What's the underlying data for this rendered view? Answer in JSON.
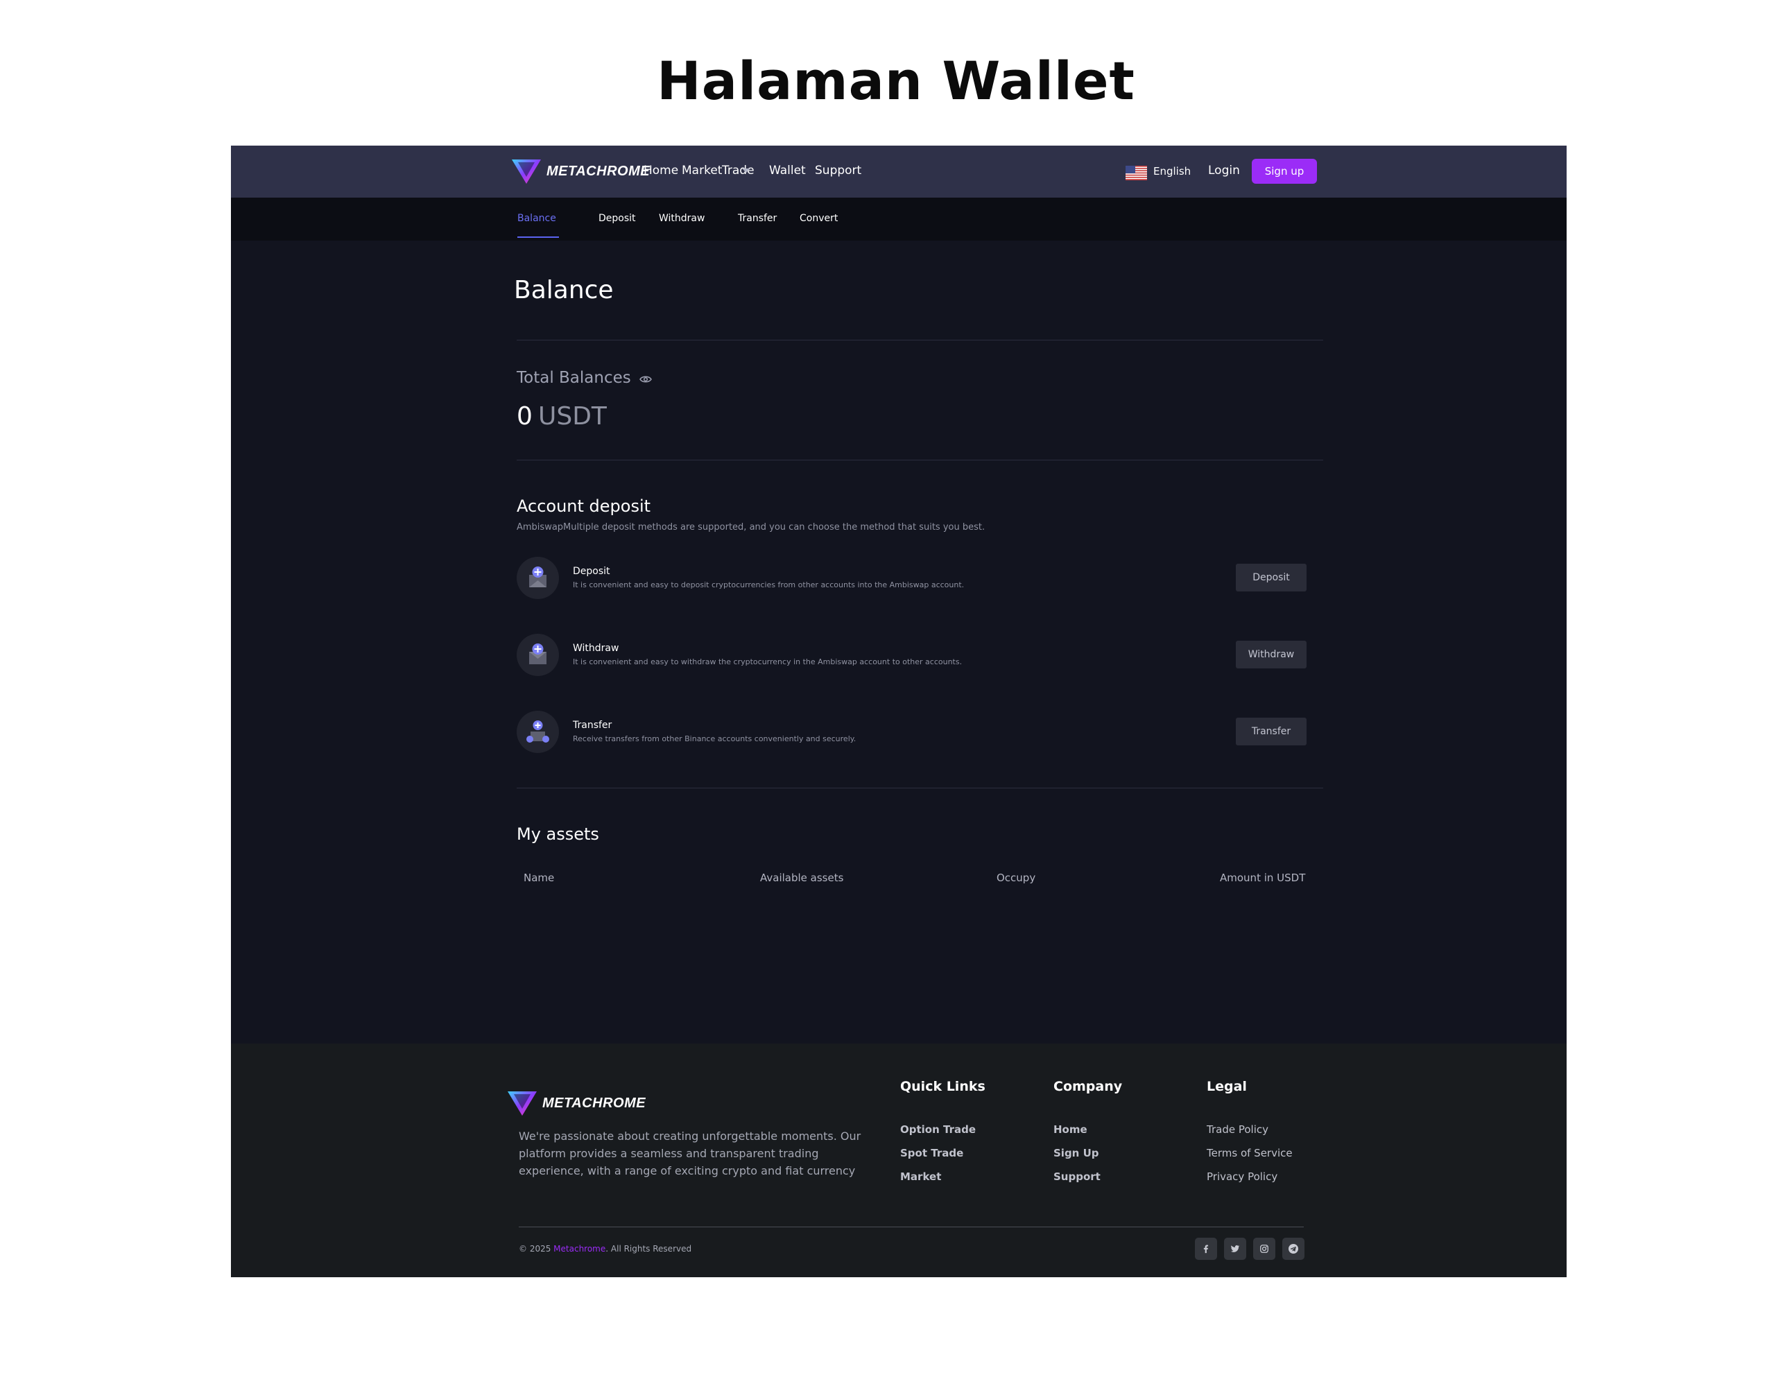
{
  "heading": "Halaman Wallet",
  "brand": {
    "name": "METACHROME",
    "accent": "#9b2cf7"
  },
  "navbar": {
    "links": {
      "home": "Home",
      "market": "Market",
      "trade": "Trade",
      "wallet": "Wallet",
      "support": "Support"
    },
    "language": "English",
    "login": "Login",
    "signup": "Sign up"
  },
  "subnav": {
    "balance": "Balance",
    "deposit": "Deposit",
    "withdraw": "Withdraw",
    "transfer": "Transfer",
    "convert": "Convert",
    "active": "Balance"
  },
  "main": {
    "title": "Balance",
    "total_label": "Total Balances",
    "total_amount": "0",
    "total_currency": "USDT",
    "account_deposit": {
      "title": "Account deposit",
      "subtitle": "AmbiswapMultiple deposit methods are supported, and you can choose the method that suits you best.",
      "methods": [
        {
          "icon": "deposit-icon",
          "title": "Deposit",
          "desc": "It is convenient and easy to deposit cryptocurrencies from other accounts into the Ambiswap account.",
          "button": "Deposit"
        },
        {
          "icon": "withdraw-icon",
          "title": "Withdraw",
          "desc": "It is convenient and easy to withdraw the cryptocurrency in the Ambiswap account to other accounts.",
          "button": "Withdraw"
        },
        {
          "icon": "transfer-icon",
          "title": "Transfer",
          "desc": "Receive transfers from other Binance accounts conveniently and securely.",
          "button": "Transfer"
        }
      ]
    },
    "assets": {
      "title": "My assets",
      "columns": [
        "Name",
        "Available assets",
        "Occupy",
        "Amount in USDT"
      ]
    }
  },
  "footer": {
    "description": "We're passionate about creating unforgettable moments. Our platform provides a seamless and transparent trading experience, with a range of exciting crypto and fiat currency",
    "quick_links": {
      "title": "Quick Links",
      "items": [
        "Option Trade",
        "Spot Trade",
        "Market"
      ]
    },
    "company": {
      "title": "Company",
      "items": [
        "Home",
        "Sign Up",
        "Support"
      ]
    },
    "legal": {
      "title": "Legal",
      "items": [
        "Trade Policy",
        "Terms of Service",
        "Privacy Policy"
      ]
    },
    "copyright_prefix": "© 2025 ",
    "copyright_brand": "Metachrome",
    "copyright_suffix": ". All Rights Reserved",
    "social": [
      "facebook-icon",
      "twitter-icon",
      "instagram-icon",
      "telegram-icon"
    ]
  }
}
